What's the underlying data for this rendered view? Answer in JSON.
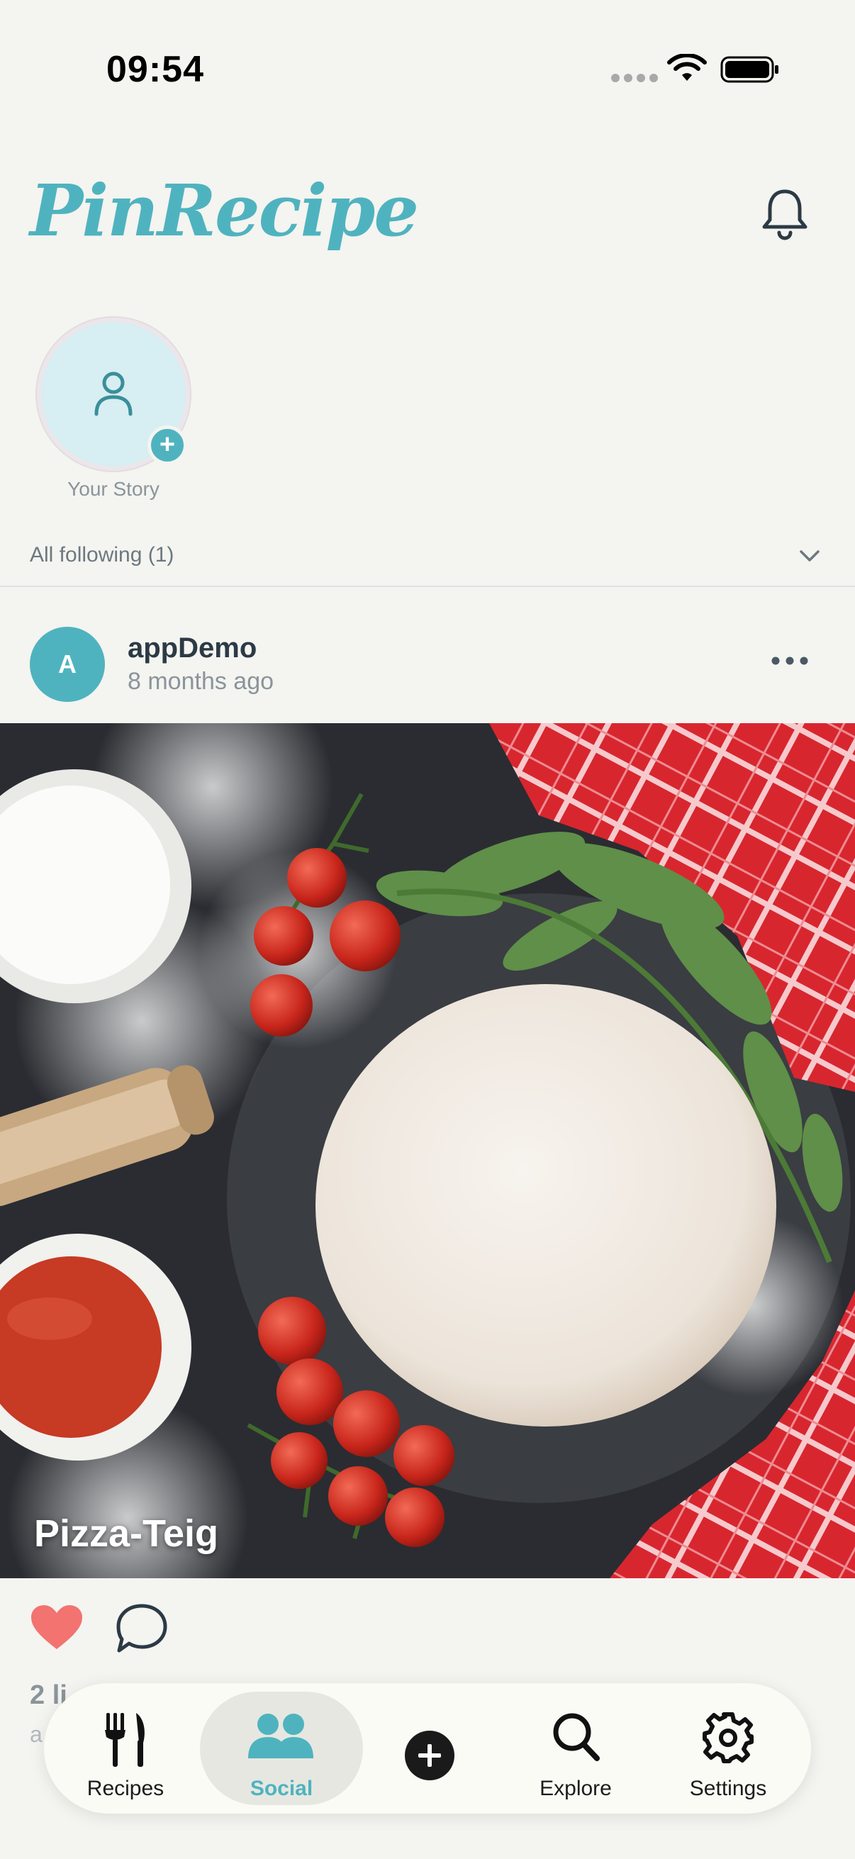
{
  "status_bar": {
    "time": "09:54",
    "icons": [
      "signal-icon",
      "wifi-icon",
      "battery-icon"
    ]
  },
  "header": {
    "brand": "PinRecipe",
    "notification_icon": "bell-icon"
  },
  "stories": {
    "own": {
      "label": "Your Story",
      "add_badge": "+"
    }
  },
  "filter": {
    "label": "All following (1)",
    "icon": "chevron-down-icon"
  },
  "post": {
    "avatar_initial": "A",
    "username": "appDemo",
    "time_ago": "8 months ago",
    "menu_icon": "more-icon",
    "image_title": "Pizza-Teig",
    "liked": true,
    "likes_text": "2 li",
    "caption_text": "a"
  },
  "tab_bar": {
    "active": "Social",
    "items": [
      {
        "label": "Recipes",
        "icon": "fork-knife-icon"
      },
      {
        "label": "Social",
        "icon": "people-icon"
      },
      {
        "label": "",
        "icon": "plus-circle-icon"
      },
      {
        "label": "Explore",
        "icon": "search-icon"
      },
      {
        "label": "Settings",
        "icon": "gear-icon"
      }
    ]
  },
  "colors": {
    "accent": "#4fb3bf",
    "background": "#f4f4f0",
    "like": "#f2736f",
    "text_dark": "#2b3a45",
    "text_muted": "#8a949b"
  }
}
